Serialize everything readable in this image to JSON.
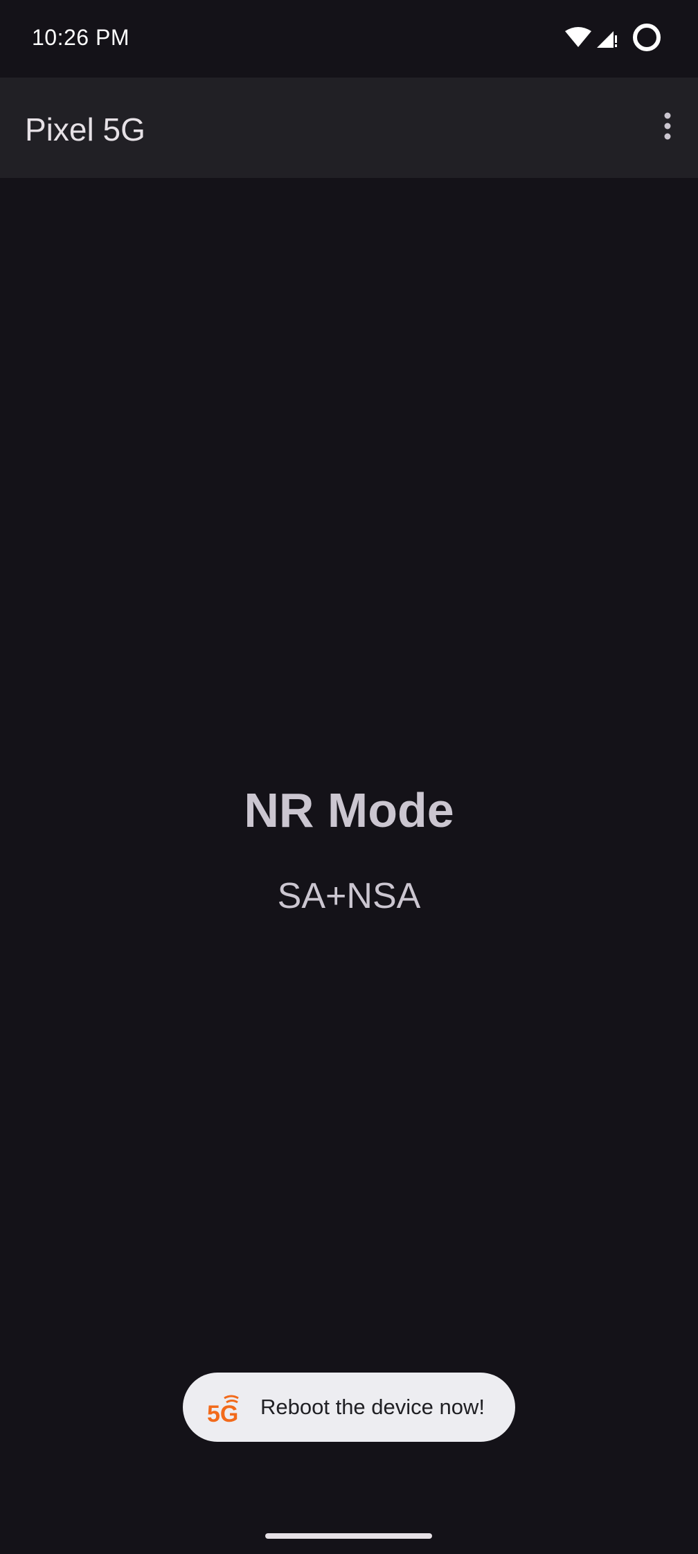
{
  "status_bar": {
    "time": "10:26 PM",
    "icons": [
      "wifi-icon",
      "cell-signal-icon",
      "circle-status-icon"
    ]
  },
  "app_bar": {
    "title": "Pixel 5G",
    "menu_icon": "more-vert-icon"
  },
  "main": {
    "heading": "NR Mode",
    "value": "SA+NSA"
  },
  "toast": {
    "icon": "5g-logo-icon",
    "message": "Reboot the device now!"
  },
  "colors": {
    "background": "#141218",
    "app_bar": "#212025",
    "text": "#cbc6d0",
    "toast_bg": "#ededf1",
    "brand_orange": "#f26a1b"
  }
}
